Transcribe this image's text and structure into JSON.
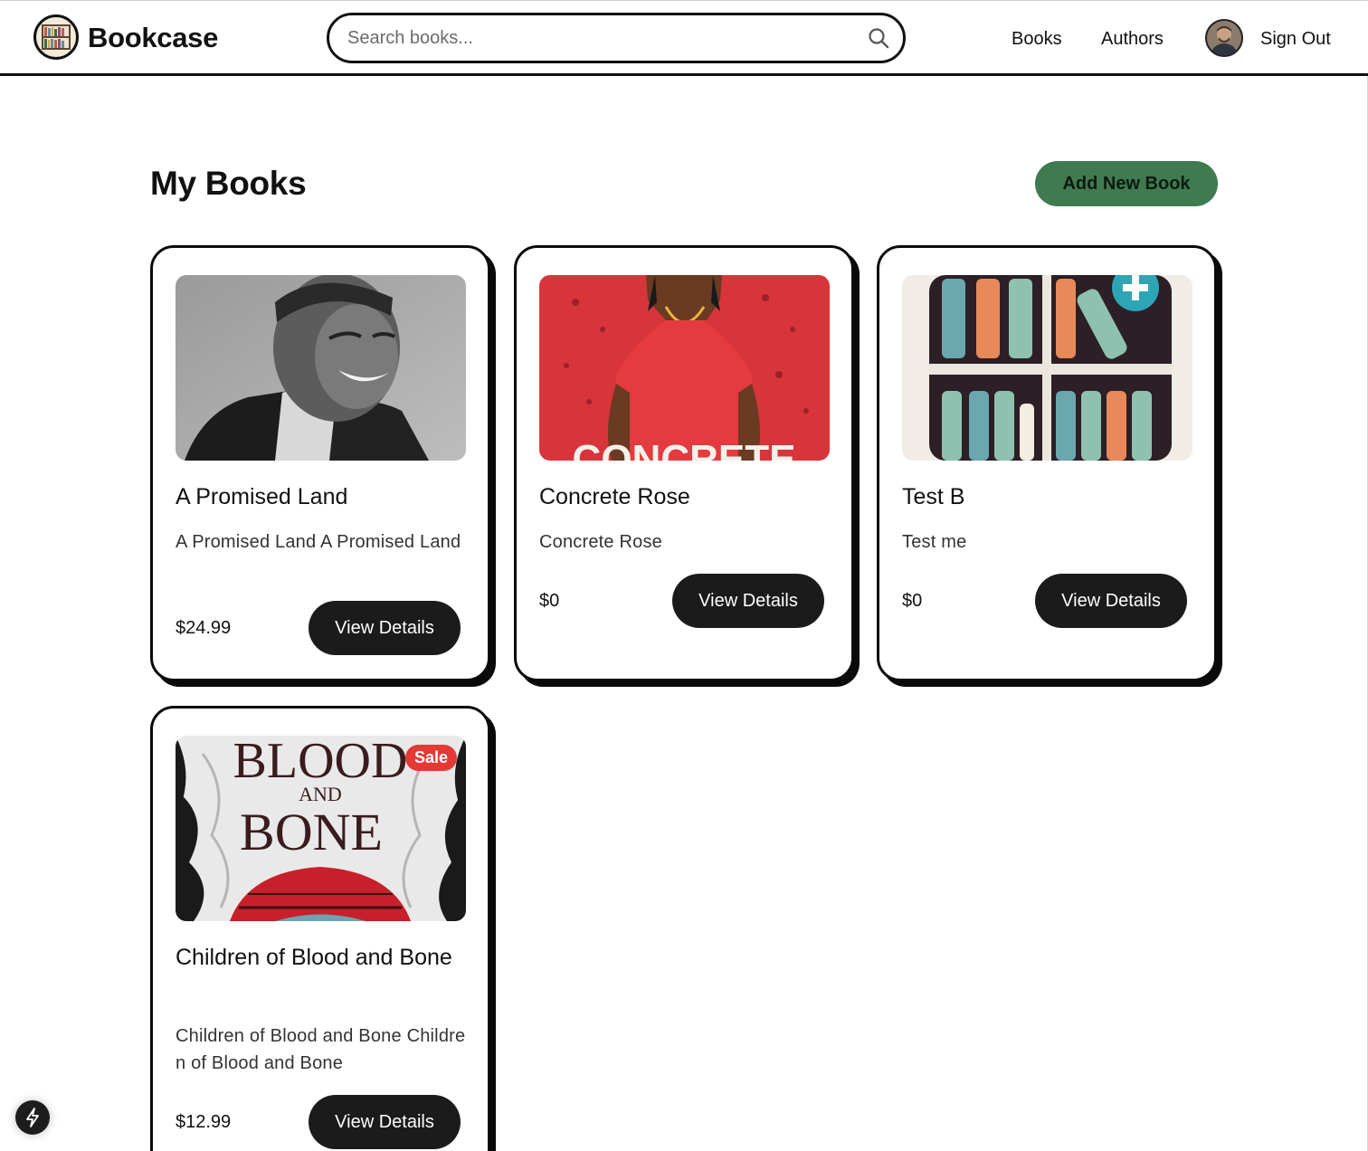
{
  "header": {
    "brand": "Bookcase",
    "search": {
      "placeholder": "Search books..."
    },
    "nav": {
      "books": "Books",
      "authors": "Authors",
      "sign_out": "Sign Out"
    }
  },
  "main": {
    "title": "My Books",
    "add_button": "Add New Book"
  },
  "books": [
    {
      "title": "A Promised Land",
      "description": "A Promised Land A Promised Land",
      "price": "$24.99",
      "button": "View Details"
    },
    {
      "title": "Concrete Rose",
      "description": "Concrete Rose",
      "price": "$0",
      "button": "View Details",
      "cover_text": "CONCRETE"
    },
    {
      "title": "Test B",
      "description": "Test me",
      "price": "$0",
      "button": "View Details"
    },
    {
      "title": "Children of Blood and Bone",
      "description": "Children of Blood and Bone Children of Blood and Bone",
      "price": "$12.99",
      "button": "View Details",
      "badge": "Sale",
      "cover_text": {
        "line1": "BLOOD",
        "line2": "AND",
        "line3": "BONE"
      }
    }
  ],
  "colors": {
    "accent": "#3f7a50",
    "button_dark": "#1b1b1b",
    "sale": "#e53935"
  }
}
